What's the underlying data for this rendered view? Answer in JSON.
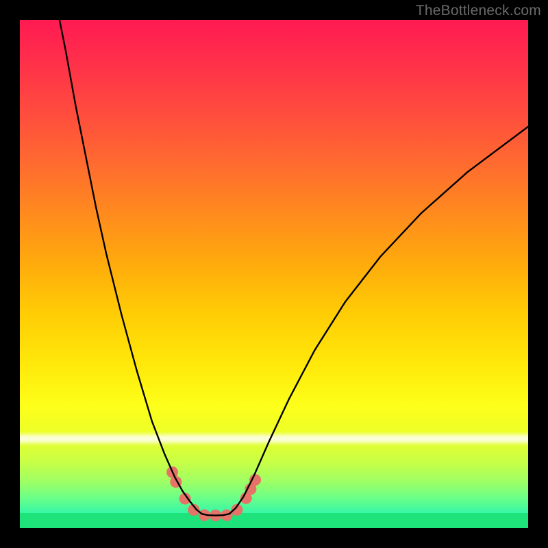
{
  "watermark": "TheBottleneck.com",
  "chart_data": {
    "type": "line",
    "title": "",
    "xlabel": "",
    "ylabel": "",
    "xlim": [
      0,
      100
    ],
    "ylim": [
      0,
      100
    ],
    "series": [
      {
        "name": "left-branch",
        "x": [
          7.8,
          9,
          11,
          13,
          15,
          17,
          20,
          23,
          26,
          28.5,
          30.5,
          32,
          33.5,
          34.7,
          35.8
        ],
        "y": [
          100,
          94,
          83,
          73,
          63,
          54,
          42,
          31,
          21,
          14.5,
          10,
          7.3,
          5.2,
          3.7,
          2.8
        ]
      },
      {
        "name": "valley-floor",
        "x": [
          35.8,
          37.0,
          38.5,
          40.0,
          41.2
        ],
        "y": [
          2.8,
          2.55,
          2.5,
          2.55,
          2.8
        ]
      },
      {
        "name": "right-branch",
        "x": [
          41.2,
          42.5,
          44,
          46,
          49,
          53,
          58,
          64,
          71,
          79,
          88,
          100
        ],
        "y": [
          2.8,
          4.0,
          6.2,
          10.2,
          17.0,
          25.5,
          35.0,
          44.5,
          53.5,
          62.0,
          70.0,
          79.0
        ]
      }
    ],
    "markers": {
      "name": "salmon-dots",
      "color": "#e57368",
      "radius_percent": 1.15,
      "points": [
        {
          "x": 30.0,
          "y": 11.0
        },
        {
          "x": 30.7,
          "y": 9.1
        },
        {
          "x": 32.5,
          "y": 5.8
        },
        {
          "x": 34.2,
          "y": 3.6
        },
        {
          "x": 36.3,
          "y": 2.55
        },
        {
          "x": 38.5,
          "y": 2.5
        },
        {
          "x": 40.7,
          "y": 2.55
        },
        {
          "x": 42.7,
          "y": 3.6
        },
        {
          "x": 44.5,
          "y": 5.9
        },
        {
          "x": 45.4,
          "y": 7.7
        },
        {
          "x": 46.3,
          "y": 9.5
        }
      ]
    },
    "bands": [
      {
        "name": "pale-band",
        "y_center": 17.6,
        "height": 2.8
      },
      {
        "name": "green-floor",
        "y_bottom": 0,
        "height": 2.9
      }
    ],
    "gradient_stops": [
      {
        "pos": 0,
        "color": "#ff1a52"
      },
      {
        "pos": 50,
        "color": "#ffab0c"
      },
      {
        "pos": 75,
        "color": "#fdff1a"
      },
      {
        "pos": 100,
        "color": "#19e9b0"
      }
    ]
  }
}
